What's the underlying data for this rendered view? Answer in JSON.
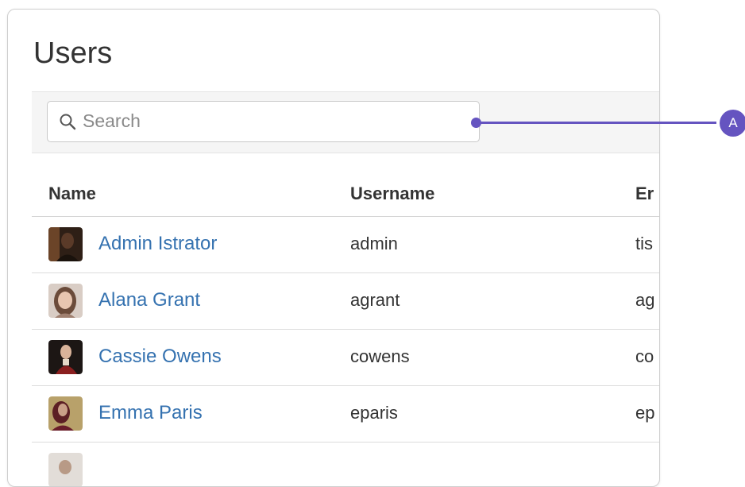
{
  "page": {
    "title": "Users"
  },
  "search": {
    "placeholder": "Search",
    "value": ""
  },
  "table": {
    "columns": [
      "Name",
      "Username",
      "Er"
    ],
    "rows": [
      {
        "name": "Admin Istrator",
        "username": "admin",
        "email": "tis",
        "avatar": "avatar-dark"
      },
      {
        "name": "Alana Grant",
        "username": "agrant",
        "email": "ag",
        "avatar": "avatar-light"
      },
      {
        "name": "Cassie Owens",
        "username": "cowens",
        "email": "co",
        "avatar": "avatar-red"
      },
      {
        "name": "Emma Paris",
        "username": "eparis",
        "email": "ep",
        "avatar": "avatar-maroon"
      }
    ]
  },
  "callout": {
    "label": "A",
    "color": "#6554c0"
  },
  "colors": {
    "link": "#3572b0",
    "text": "#333333",
    "toolbar_bg": "#f5f5f5",
    "accent": "#6554c0"
  }
}
